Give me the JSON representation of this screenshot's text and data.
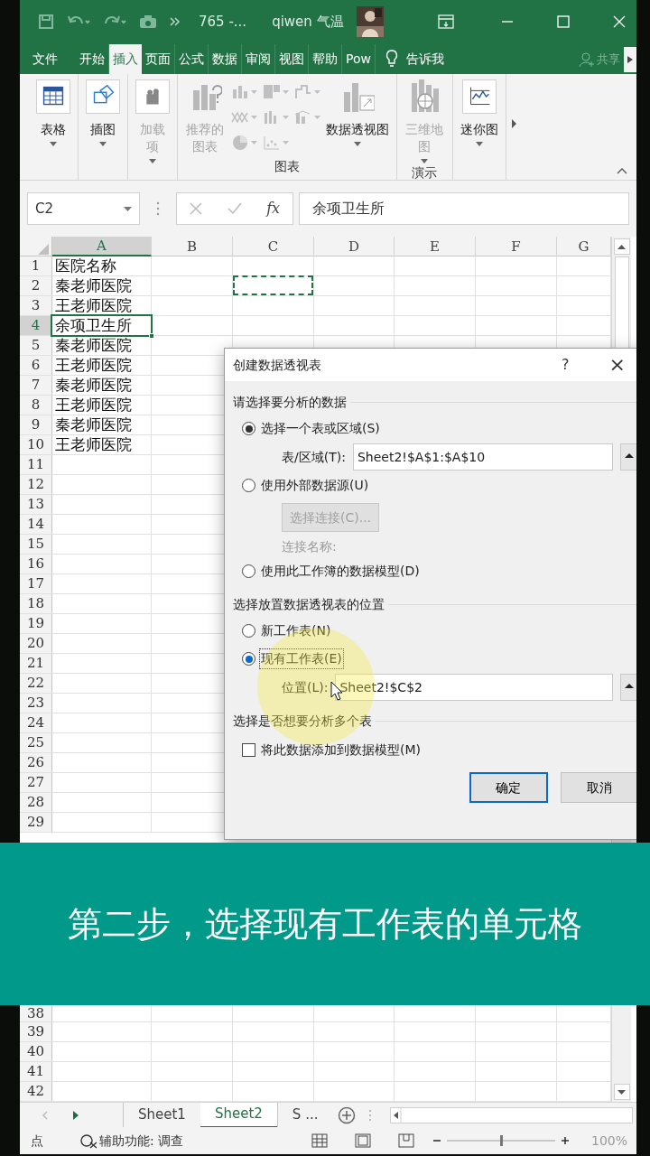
{
  "title_bar": {
    "title": "765 -...",
    "user": "qiwen 气温"
  },
  "ribbon_tabs": [
    {
      "label": "文件",
      "selected": false
    },
    {
      "label": "开始",
      "selected": false
    },
    {
      "label": "插入",
      "selected": true
    },
    {
      "label": "页面",
      "selected": false
    },
    {
      "label": "公式",
      "selected": false
    },
    {
      "label": "数据",
      "selected": false
    },
    {
      "label": "审阅",
      "selected": false
    },
    {
      "label": "视图",
      "selected": false
    },
    {
      "label": "帮助",
      "selected": false
    },
    {
      "label": "Pow",
      "selected": false
    }
  ],
  "tell_me": "告诉我",
  "share": "共享",
  "ribbon_groups": [
    {
      "buttons": [
        {
          "kind": "table",
          "label": "表格",
          "disabled": false,
          "dropdown": true
        }
      ]
    },
    {
      "buttons": [
        {
          "kind": "illustration",
          "label": "插图",
          "disabled": false,
          "dropdown": true
        }
      ]
    },
    {
      "buttons": [
        {
          "kind": "addin",
          "label": "加载项",
          "disabled": true,
          "dropdown": true
        }
      ]
    },
    {
      "label": "图表",
      "buttons": [
        {
          "kind": "recommended",
          "label": "推荐的图表",
          "disabled": true,
          "dropdown": false
        },
        {
          "kind": "chart-grid"
        },
        {
          "kind": "pivotchart",
          "label": "数据透视图",
          "disabled": false,
          "dropdown": true
        }
      ]
    },
    {
      "label": "演示",
      "buttons": [
        {
          "kind": "map",
          "label": "三维地图",
          "disabled": true,
          "dropdown": true
        }
      ]
    },
    {
      "buttons": [
        {
          "kind": "sparkline",
          "label": "迷你图",
          "disabled": false,
          "dropdown": true
        }
      ]
    }
  ],
  "formula_bar": {
    "name_box": "C2",
    "fx": "fx",
    "formula": "余项卫生所"
  },
  "grid": {
    "columns": [
      {
        "label": "A",
        "selected": true
      },
      {
        "label": "B",
        "selected": false
      },
      {
        "label": "C",
        "selected": false
      },
      {
        "label": "D",
        "selected": false
      },
      {
        "label": "E",
        "selected": false
      },
      {
        "label": "F",
        "selected": false
      },
      {
        "label": "G",
        "selected": false
      }
    ],
    "rows": [
      {
        "label": "1",
        "value": "医院名称",
        "selected": false,
        "marquee": false
      },
      {
        "label": "2",
        "value": "秦老师医院",
        "selected": false,
        "marquee": true
      },
      {
        "label": "3",
        "value": "王老师医院",
        "selected": false,
        "marquee": false
      },
      {
        "label": "4",
        "value": "余项卫生所",
        "selected": true,
        "marquee": false
      },
      {
        "label": "5",
        "value": "秦老师医院",
        "selected": false,
        "marquee": false
      },
      {
        "label": "6",
        "value": "王老师医院",
        "selected": false,
        "marquee": false
      },
      {
        "label": "7",
        "value": "秦老师医院",
        "selected": false,
        "marquee": false
      },
      {
        "label": "8",
        "value": "王老师医院",
        "selected": false,
        "marquee": false
      },
      {
        "label": "9",
        "value": "秦老师医院",
        "selected": false,
        "marquee": false
      },
      {
        "label": "10",
        "value": "王老师医院",
        "selected": false,
        "marquee": false
      },
      {
        "label": "11",
        "selected": false,
        "marquee": false
      },
      {
        "label": "12",
        "selected": false,
        "marquee": false
      },
      {
        "label": "13",
        "selected": false,
        "marquee": false
      },
      {
        "label": "14",
        "selected": false,
        "marquee": false
      },
      {
        "label": "15",
        "selected": false,
        "marquee": false
      },
      {
        "label": "16",
        "selected": false,
        "marquee": false
      },
      {
        "label": "17",
        "selected": false,
        "marquee": false
      },
      {
        "label": "18",
        "selected": false,
        "marquee": false
      },
      {
        "label": "19",
        "selected": false,
        "marquee": false
      },
      {
        "label": "20",
        "selected": false,
        "marquee": false
      },
      {
        "label": "21",
        "selected": false,
        "marquee": false
      },
      {
        "label": "22",
        "selected": false,
        "marquee": false
      },
      {
        "label": "23",
        "selected": false,
        "marquee": false
      },
      {
        "label": "24",
        "selected": false,
        "marquee": false
      },
      {
        "label": "25",
        "selected": false,
        "marquee": false
      },
      {
        "label": "26",
        "selected": false,
        "marquee": false
      },
      {
        "label": "27",
        "selected": false,
        "marquee": false
      },
      {
        "label": "28",
        "selected": false,
        "marquee": false
      },
      {
        "label": "29",
        "selected": false,
        "marquee": false
      }
    ],
    "lower_rows": [
      {
        "label": "38",
        "selected": false,
        "marquee": false
      },
      {
        "label": "39",
        "selected": false,
        "marquee": false
      },
      {
        "label": "40",
        "selected": false,
        "marquee": false
      },
      {
        "label": "41",
        "selected": false,
        "marquee": false
      },
      {
        "label": "42",
        "selected": false,
        "marquee": false
      }
    ]
  },
  "dialog": {
    "title": "创建数据透视表",
    "help": "?",
    "close": "×",
    "sections": [
      {
        "heading": "请选择要分析的数据",
        "items": [
          {
            "kind": "radio",
            "label": "选择一个表或区域(S)",
            "selected": true,
            "focused": false
          },
          {
            "kind": "field",
            "label": "表/区域(T):",
            "value": "Sheet2!$A$1:$A$10"
          },
          {
            "kind": "radio",
            "label": "使用外部数据源(U)",
            "selected": false,
            "focused": false
          },
          {
            "kind": "button",
            "label": "选择连接(C)...",
            "disabled": true
          },
          {
            "kind": "note",
            "label": "连接名称:",
            "disabled": true
          },
          {
            "kind": "radio",
            "label": "使用此工作簿的数据模型(D)",
            "selected": false,
            "focused": false
          }
        ]
      },
      {
        "heading": "选择放置数据透视表的位置",
        "items": [
          {
            "kind": "radio",
            "label": "新工作表(N)",
            "selected": false,
            "focused": false
          },
          {
            "kind": "radio",
            "label": "现有工作表(E)",
            "selected": true,
            "focused": true
          },
          {
            "kind": "field",
            "label": "位置(L):",
            "value": "Sheet2!$C$2"
          }
        ]
      },
      {
        "heading": "选择是否想要分析多个表",
        "items": [
          {
            "kind": "checkbox",
            "label": "将此数据添加到数据模型(M)",
            "checked": false
          }
        ]
      }
    ],
    "buttons": [
      {
        "label": "确定",
        "default": true
      },
      {
        "label": "取消",
        "default": false
      }
    ]
  },
  "sheet_tabs": [
    {
      "label": "Sheet1",
      "selected": false
    },
    {
      "label": "Sheet2",
      "selected": true
    },
    {
      "label": "S ...",
      "selected": false
    }
  ],
  "status_bar": {
    "mode": "点",
    "accessibility": "辅助功能: 调查",
    "zoom": {
      "level": 0.5,
      "reading": "100%"
    }
  },
  "caption": "第二步，选择现有工作表的单元格"
}
